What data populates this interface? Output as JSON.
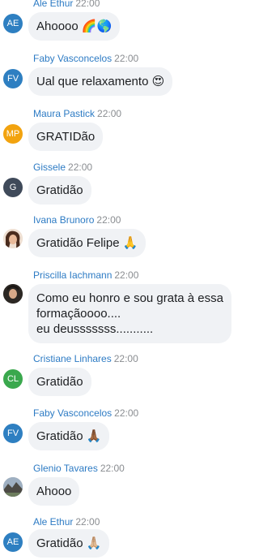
{
  "messages": [
    {
      "initials": "AE",
      "color": "#2e7fc1",
      "name": "Ale Ethur",
      "time": "22:00",
      "text": "Ahoooo",
      "emoji": "🌈🌎"
    },
    {
      "initials": "FV",
      "color": "#2e7fc1",
      "name": "Faby Vasconcelos",
      "time": "22:00",
      "text": "Ual que relaxamento",
      "emoji": "😍"
    },
    {
      "initials": "MP",
      "color": "#f2a30f",
      "name": "Maura Pastick",
      "time": "22:00",
      "text": "GRATIDão",
      "emoji": ""
    },
    {
      "initials": "G",
      "color": "#3f4a5a",
      "name": "Gissele",
      "time": "22:00",
      "text": "Gratidão",
      "emoji": ""
    },
    {
      "initials": "",
      "color": "#5b3a2a",
      "name": "Ivana Brunoro",
      "time": "22:00",
      "text": "Gratidão Felipe",
      "emoji": "🙏"
    },
    {
      "initials": "",
      "color": "#2f2a26",
      "name": "Priscilla Iachmann",
      "time": "22:00",
      "lines": [
        "Como eu honro e sou grata à essa",
        "formaçãoooo....",
        "eu deusssssss..........."
      ]
    },
    {
      "initials": "CL",
      "color": "#3aa84d",
      "name": "Cristiane Linhares",
      "time": "22:00",
      "text": "Gratidão",
      "emoji": ""
    },
    {
      "initials": "FV",
      "color": "#2e7fc1",
      "name": "Faby Vasconcelos",
      "time": "22:00",
      "text": "Gratidão",
      "emoji": "🙏🏾"
    },
    {
      "initials": "",
      "color": "#7c8a99",
      "name": "Glenio Tavares",
      "time": "22:00",
      "text": "Ahooo",
      "emoji": ""
    },
    {
      "initials": "AE",
      "color": "#2e7fc1",
      "name": "Ale Ethur",
      "time": "22:00",
      "text": "Gratidão",
      "emoji": "🙏🏼"
    }
  ]
}
